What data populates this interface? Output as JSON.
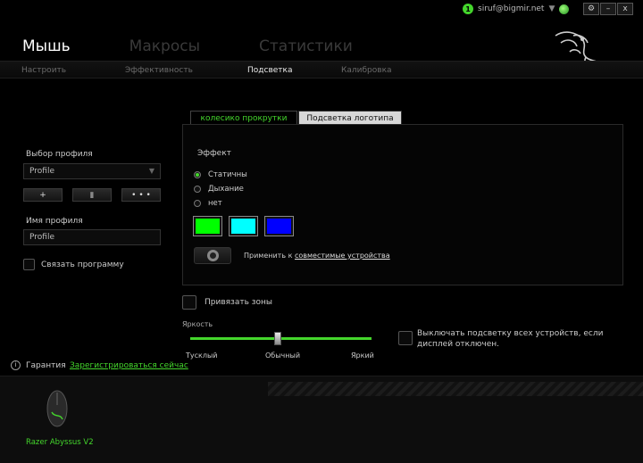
{
  "header": {
    "notification_count": "1",
    "user_email": "siruf@bigmir.net",
    "window_buttons": [
      "⚙",
      "–",
      "x"
    ],
    "main_tabs": [
      "Мышь",
      "Макросы",
      "Статистики"
    ],
    "sub_tabs": [
      "Настроить",
      "Эффективность",
      "Подсветка",
      "Калибровка"
    ]
  },
  "profile": {
    "select_label": "Выбор профиля",
    "selected": "Profile",
    "buttons": [
      "+",
      "▮",
      "• • •"
    ],
    "name_label": "Имя профиля",
    "name_value": "Profile",
    "link_program_label": "Связать программу"
  },
  "lighting": {
    "tabs": [
      "колесико прокрутки",
      "Подсветка логотипа"
    ],
    "effect_label": "Эффект",
    "effects": [
      "Статичны",
      "Дыхание",
      "нет"
    ],
    "selected_effect": "Статичны",
    "colors": [
      "#00ff00",
      "#00ffff",
      "#0000ff"
    ],
    "apply_text": "Применить к",
    "apply_link": "совместимые устройства",
    "bind_zones_label": "Привязать зоны",
    "brightness_label": "Яркость",
    "brightness_stops": [
      "Тусклый",
      "Обычный",
      "Яркий"
    ],
    "brightness_value": 0.5,
    "turn_off_label": "Выключать подсветку всех устройств, если дисплей отключен."
  },
  "footer": {
    "warranty_label": "Гарантия",
    "register_link": "Зарегистрироваться сейчас",
    "device_name": "Razer Abyssus V2"
  },
  "colors": {
    "accent": "#44d62c"
  }
}
